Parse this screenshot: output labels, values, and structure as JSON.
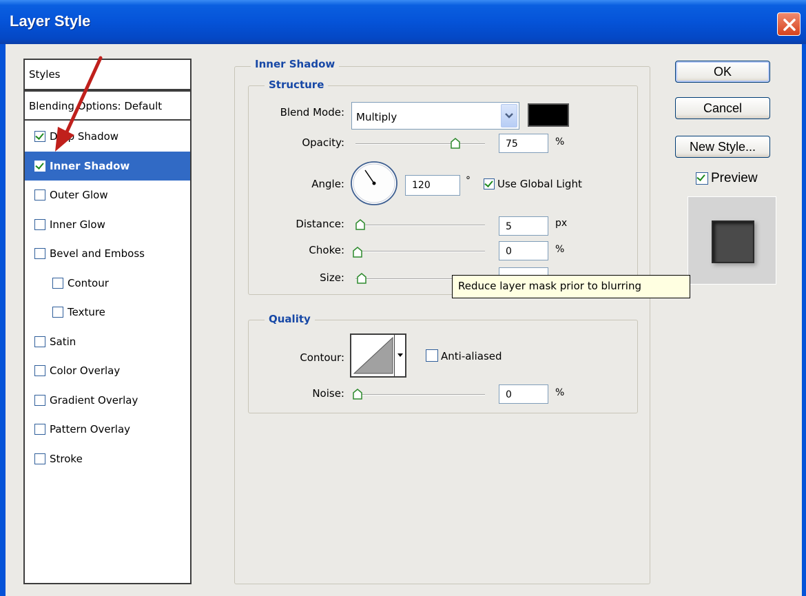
{
  "window": {
    "title": "Layer Style"
  },
  "styles_list": {
    "header": "Styles",
    "blending_options": "Blending Options: Default",
    "items": [
      {
        "label": "Drop Shadow",
        "checked": true,
        "selected": false,
        "indent": false
      },
      {
        "label": "Inner Shadow",
        "checked": true,
        "selected": true,
        "indent": false
      },
      {
        "label": "Outer Glow",
        "checked": false,
        "selected": false,
        "indent": false
      },
      {
        "label": "Inner Glow",
        "checked": false,
        "selected": false,
        "indent": false
      },
      {
        "label": "Bevel and Emboss",
        "checked": false,
        "selected": false,
        "indent": false
      },
      {
        "label": "Contour",
        "checked": false,
        "selected": false,
        "indent": true
      },
      {
        "label": "Texture",
        "checked": false,
        "selected": false,
        "indent": true
      },
      {
        "label": "Satin",
        "checked": false,
        "selected": false,
        "indent": false
      },
      {
        "label": "Color Overlay",
        "checked": false,
        "selected": false,
        "indent": false
      },
      {
        "label": "Gradient Overlay",
        "checked": false,
        "selected": false,
        "indent": false
      },
      {
        "label": "Pattern Overlay",
        "checked": false,
        "selected": false,
        "indent": false
      },
      {
        "label": "Stroke",
        "checked": false,
        "selected": false,
        "indent": false
      }
    ]
  },
  "inner_shadow": {
    "title": "Inner Shadow",
    "structure": {
      "title": "Structure",
      "blend_mode_label": "Blend Mode:",
      "blend_mode_value": "Multiply",
      "shadow_color": "#000000",
      "opacity_label": "Opacity:",
      "opacity_value": "75",
      "opacity_unit": "%",
      "angle_label": "Angle:",
      "angle_value": "120",
      "angle_unit": "°",
      "use_global_light_label": "Use Global Light",
      "use_global_light_checked": true,
      "distance_label": "Distance:",
      "distance_value": "5",
      "distance_unit": "px",
      "choke_label": "Choke:",
      "choke_value": "0",
      "choke_unit": "%",
      "size_label": "Size:"
    },
    "quality": {
      "title": "Quality",
      "contour_label": "Contour:",
      "anti_aliased_label": "Anti-aliased",
      "anti_aliased_checked": false,
      "noise_label": "Noise:",
      "noise_value": "0",
      "noise_unit": "%"
    }
  },
  "buttons": {
    "ok": "OK",
    "cancel": "Cancel",
    "new_style": "New Style..."
  },
  "preview": {
    "label": "Preview",
    "checked": true
  },
  "tooltip": "Reduce layer mask prior to blurring",
  "colors": {
    "accent": "#316ac5",
    "title_bar": "#0553d8",
    "group_title": "#1748a6"
  },
  "icons": [
    "close-icon",
    "dropdown-arrow-icon",
    "angle-dial-icon",
    "contour-curve-icon",
    "red-arrow-annotation"
  ]
}
